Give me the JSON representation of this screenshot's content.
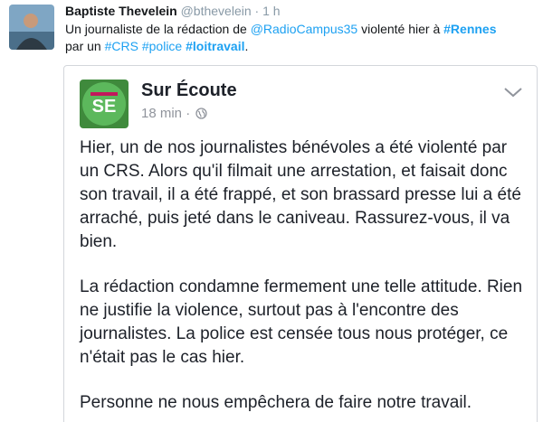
{
  "tweet": {
    "display_name": "Baptiste Thevelein",
    "handle": "@bthevelein",
    "separator": "·",
    "time": "1 h",
    "text_1": "Un journaliste de la rédaction de ",
    "mention": "@RadioCampus35",
    "text_2": " violenté hier à ",
    "hashtag_rennes": "#Rennes",
    "text_3": "par un ",
    "hashtag_crs": "#CRS",
    "hashtag_police": "#police",
    "hashtag_loitravail": "#loitravail",
    "text_end": "."
  },
  "embed": {
    "page_name": "Sur Écoute",
    "logo_text": "SE",
    "post_time": "18 min",
    "meta_separator": "·",
    "paragraphs": [
      "Hier, un de nos journalistes bénévoles a été violenté par un CRS. Alors qu'il filmait une arrestation, et faisait donc son travail, il a été frappé, et son brassard presse lui a été arraché, puis jeté dans le caniveau. Rassurez-vous, il va bien.",
      "La rédaction condamne fermement une telle attitude. Rien ne justifie la violence, surtout pas à l'encontre des journalistes. La police est censée tous nous protéger, ce n'était pas le cas hier.",
      "Personne ne nous empêchera de faire notre travail."
    ]
  },
  "icons": {
    "globe": "globe-icon",
    "chevron": "chevron-down-icon"
  },
  "colors": {
    "link": "#1da1f2",
    "logo_green": "#4caf50",
    "logo_pink": "#c2185b"
  }
}
